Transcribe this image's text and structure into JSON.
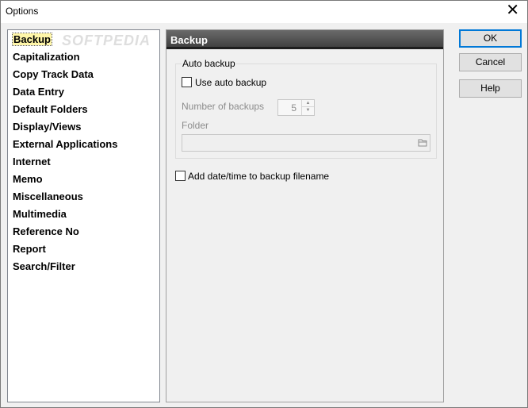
{
  "window": {
    "title": "Options"
  },
  "categories": [
    "Backup",
    "Capitalization",
    "Copy Track Data",
    "Data Entry",
    "Default Folders",
    "Display/Views",
    "External Applications",
    "Internet",
    "Memo",
    "Miscellaneous",
    "Multimedia",
    "Reference No",
    "Report",
    "Search/Filter"
  ],
  "selected_category": "Backup",
  "watermark": "SOFTPEDIA",
  "section": {
    "header": "Backup",
    "auto_backup_group": {
      "title": "Auto backup",
      "use_auto_backup_label": "Use auto backup",
      "use_auto_backup_checked": false,
      "number_of_backups_label": "Number of backups",
      "number_of_backups_value": "5",
      "folder_label": "Folder",
      "folder_value": ""
    },
    "add_datetime_label": "Add date/time to backup filename",
    "add_datetime_checked": false
  },
  "buttons": {
    "ok": "OK",
    "cancel": "Cancel",
    "help": "Help"
  },
  "icons": {
    "close": "close-icon",
    "folder": "folder-icon",
    "spin_up": "arrow-up-icon",
    "spin_down": "arrow-down-icon"
  },
  "colors": {
    "selected_highlight": "#fff6a8",
    "header_gradient_top": "#6a6a6a",
    "header_gradient_bottom": "#3c3c3c",
    "default_button_border": "#0078d7"
  }
}
